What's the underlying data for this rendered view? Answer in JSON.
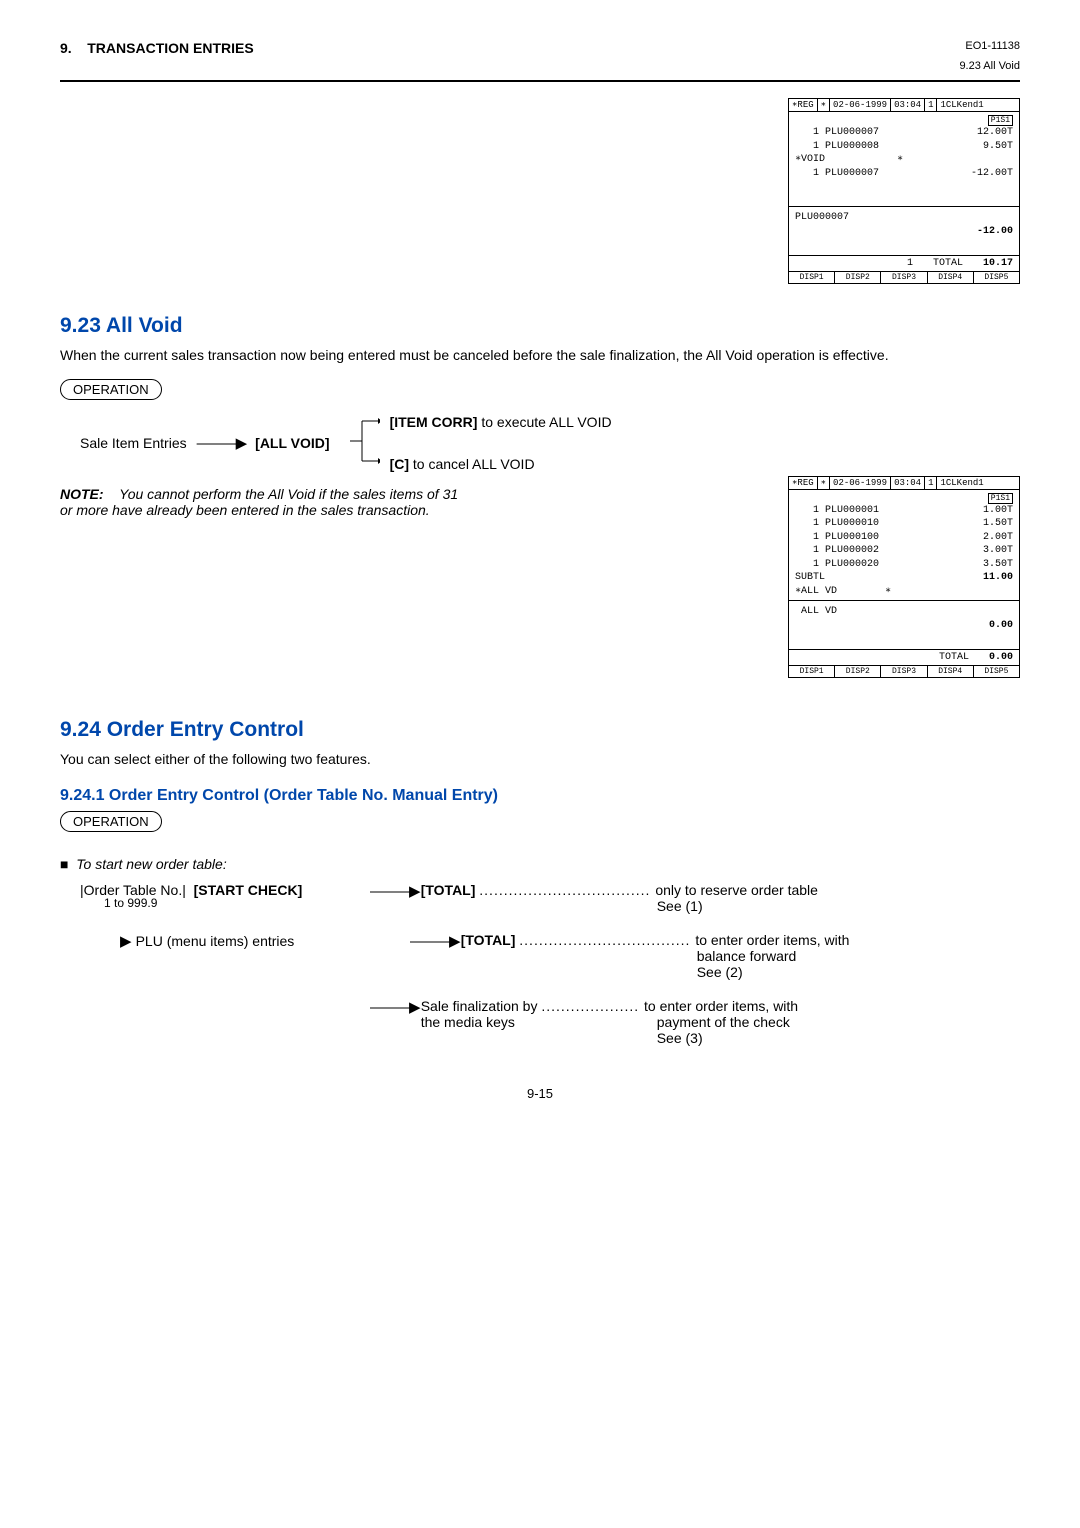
{
  "header": {
    "section": "9.",
    "title": "TRANSACTION ENTRIES",
    "doc_id": "EO1-11138",
    "breadcrumb": "9.23  All Void"
  },
  "receipt1": {
    "top": {
      "mode": "∗REG",
      "star": "∗",
      "date": "02-06-1999",
      "time": "03:04",
      "seq": "1",
      "clerk": "1CLKend1"
    },
    "badge": "P1S1",
    "rows": [
      {
        "l": "   1 PLU000007",
        "r": "12.00T"
      },
      {
        "l": "   1 PLU000008",
        "r": "9.50T"
      },
      {
        "l": "∗VOID            ∗",
        "r": ""
      },
      {
        "l": "   1 PLU000007",
        "r": "-12.00T"
      }
    ],
    "mid": {
      "name": "PLU000007",
      "amount": "-12.00"
    },
    "total": {
      "qty": "1",
      "label": "TOTAL",
      "amount": "10.17"
    },
    "disp": [
      "DISP1",
      "DISP2",
      "DISP3",
      "DISP4",
      "DISP5"
    ]
  },
  "section923": {
    "heading": "9.23   All Void",
    "intro": "When the current sales transaction now being entered must be canceled before the sale finalization, the All Void operation is effective.",
    "operation_label": "OPERATION",
    "flow": {
      "entries": "Sale Item Entries",
      "allvoid_btn": "[ALL VOID]",
      "branch1_key": "[ITEM CORR]",
      "branch1_txt": " to execute ALL VOID",
      "branch2_key": "[C]",
      "branch2_txt": " to cancel ALL VOID"
    },
    "note_label": "NOTE:",
    "note_text": "You cannot perform the All Void if the sales items of 31 or more have already been entered in the sales transaction."
  },
  "receipt2": {
    "top": {
      "mode": "∗REG",
      "star": "∗",
      "date": "02-06-1999",
      "time": "03:04",
      "seq": "1",
      "clerk": "1CLKend1"
    },
    "badge": "P1S1",
    "rows": [
      {
        "l": "   1 PLU000001",
        "r": "1.00T"
      },
      {
        "l": "   1 PLU000010",
        "r": "1.50T"
      },
      {
        "l": "   1 PLU000100",
        "r": "2.00T"
      },
      {
        "l": "   1 PLU000002",
        "r": "3.00T"
      },
      {
        "l": "   1 PLU000020",
        "r": "3.50T"
      },
      {
        "l": "SUBTL",
        "r": "11.00"
      },
      {
        "l": "∗ALL VD        ∗",
        "r": ""
      }
    ],
    "mid": {
      "name": " ALL VD",
      "amount": "0.00"
    },
    "total": {
      "qty": "",
      "label": "TOTAL",
      "amount": "0.00"
    },
    "disp": [
      "DISP1",
      "DISP2",
      "DISP3",
      "DISP4",
      "DISP5"
    ]
  },
  "section924": {
    "heading": "9.24   Order Entry Control",
    "intro": "You can select either of the following two features.",
    "sub_heading": "9.24.1   Order Entry Control (Order Table No. Manual Entry)",
    "operation_label": "OPERATION",
    "subtitle": "To start new order table:",
    "line1": {
      "range_label": "|Order Table No.|",
      "btn": "[START CHECK]",
      "range": "1 to 999.9",
      "total": "[TOTAL]",
      "dots": " ................................... ",
      "desc1": "only to reserve order table",
      "desc2": "See (1)"
    },
    "line2": {
      "label": "PLU (menu items) entries",
      "total": "[TOTAL]",
      "dots": " ................................... ",
      "desc1": "to enter order items, with",
      "desc2": "balance forward",
      "desc3": "See (2)"
    },
    "line3": {
      "label1": "Sale finalization by",
      "dots": " .................... ",
      "label2": "the media keys",
      "desc1": "to enter order items, with",
      "desc2": "payment of the check",
      "desc3": "See (3)"
    }
  },
  "page_number": "9-15"
}
